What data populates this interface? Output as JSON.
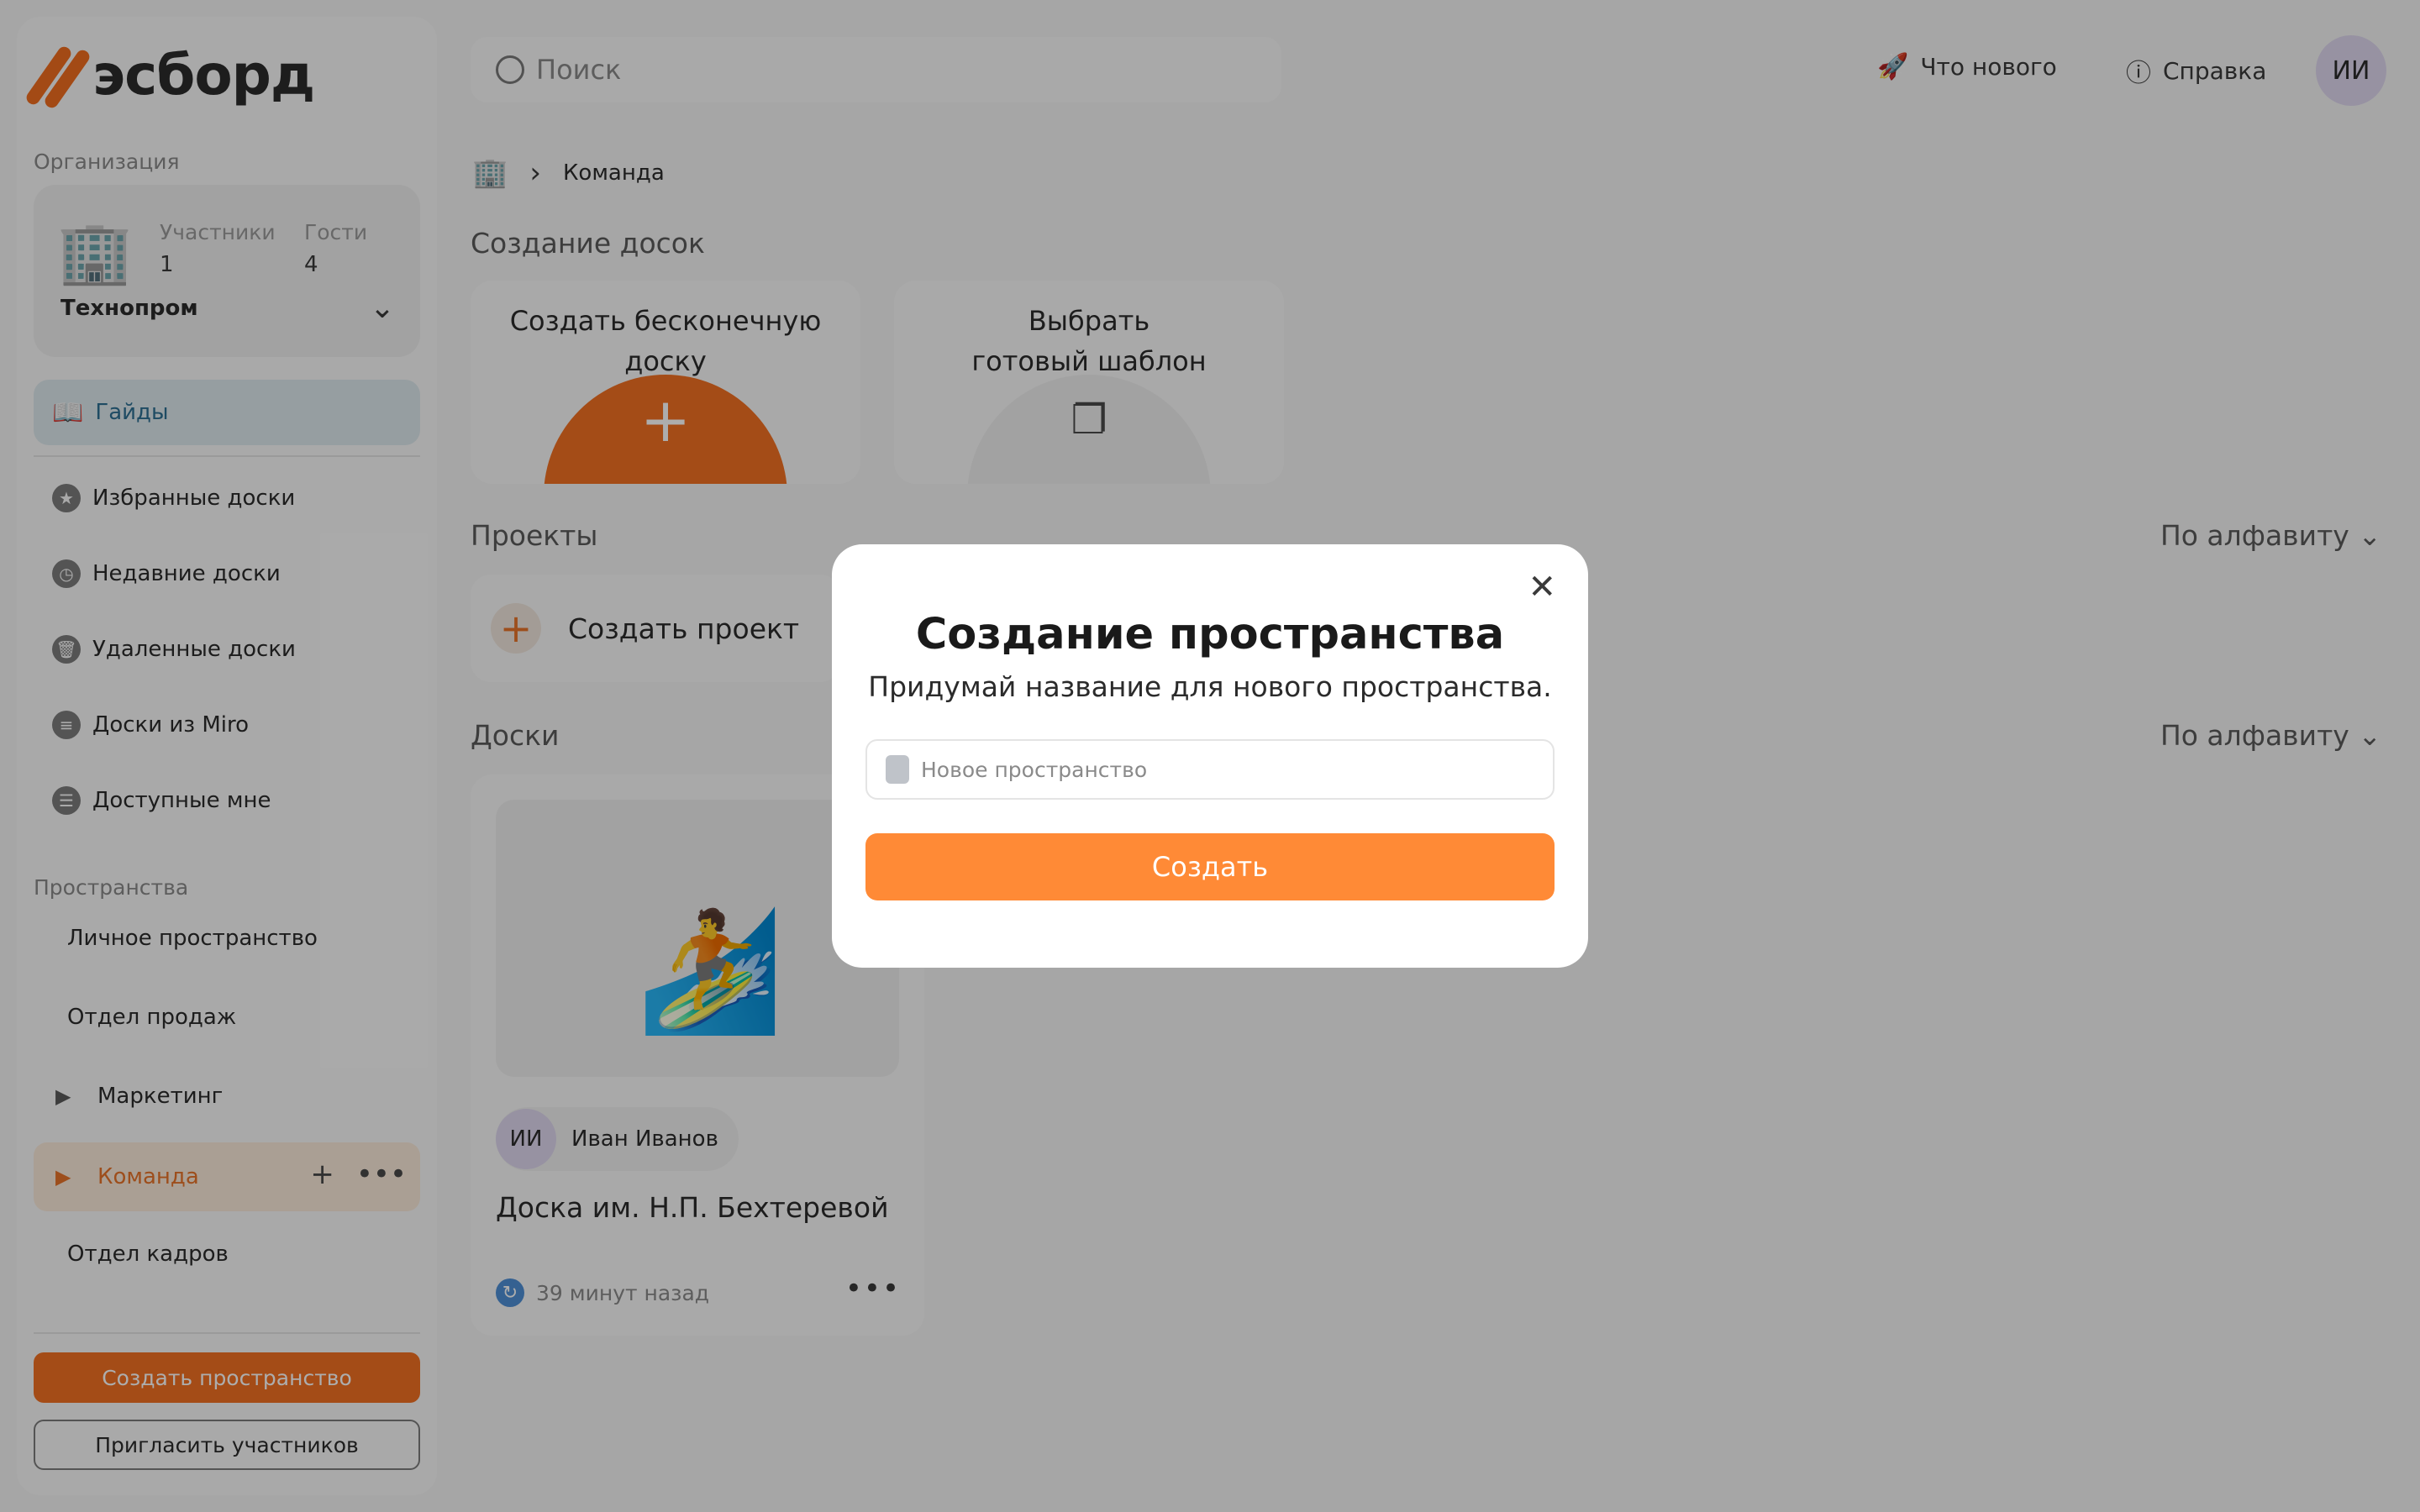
{
  "app": {
    "logo_text": "эсборд"
  },
  "sidebar": {
    "org_label": "Организация",
    "org": {
      "members_label": "Участники",
      "members_value": "1",
      "guests_label": "Гости",
      "guests_value": "4",
      "name": "Технопром"
    },
    "guides_label": "Гайды",
    "nav": [
      {
        "label": "Избранные доски",
        "icon": "star-icon"
      },
      {
        "label": "Недавние доски",
        "icon": "clock-icon"
      },
      {
        "label": "Удаленные доски",
        "icon": "trash-icon"
      },
      {
        "label": "Доски из Miro",
        "icon": "miro-icon"
      },
      {
        "label": "Доступные мне",
        "icon": "shared-icon"
      }
    ],
    "spaces_label": "Пространства",
    "spaces": [
      {
        "label": "Личное пространство"
      },
      {
        "label": "Отдел продаж"
      },
      {
        "label": "Маркетинг"
      },
      {
        "label": "Команда"
      },
      {
        "label": "Отдел кадров"
      }
    ],
    "create_space_label": "Создать пространство",
    "invite_label": "Пригласить участников"
  },
  "topbar": {
    "search_placeholder": "Поиск",
    "whats_new_label": "Что нового",
    "help_label": "Справка",
    "avatar_initials": "ИИ"
  },
  "main": {
    "breadcrumb_current": "Команда",
    "create_boards_title": "Создание досок",
    "create_infinite_label": "Создать бесконечную доску",
    "choose_template_label": "Выбрать готовый шаблон",
    "projects_title": "Проекты",
    "sort_label": "По алфавиту",
    "create_project_label": "Создать проект",
    "boards_title": "Доски",
    "board": {
      "owner_initials": "ИИ",
      "owner_name": "Иван Иванов",
      "title": "Доска им. Н.П. Бехтеревой",
      "updated": "39 минут назад"
    }
  },
  "modal": {
    "title": "Создание пространства",
    "subtitle": "Придумай название для нового пространства.",
    "input_placeholder": "Новое пространство",
    "submit_label": "Создать"
  },
  "colors": {
    "accent": "#f27022",
    "modal_button": "#ff8a36",
    "overlay": "rgba(0,0,0,0.32)"
  }
}
